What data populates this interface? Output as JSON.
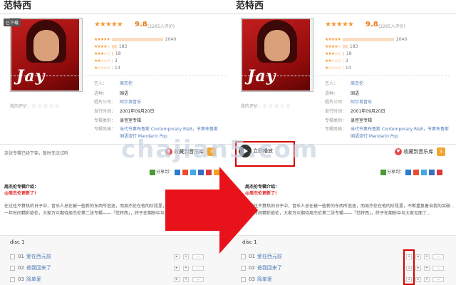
{
  "album": {
    "title": "范特西",
    "download_tag": "已下载",
    "score": "9.8",
    "rating_count": "(2265人评价)",
    "rating_rows": [
      {
        "stars": "★★★★★",
        "count": "2040",
        "fill": 0.9
      },
      {
        "stars": "★★★★☆",
        "count": "183",
        "fill": 0.08
      },
      {
        "stars": "★★★☆☆",
        "count": "18",
        "fill": 0.02
      },
      {
        "stars": "★★☆☆☆",
        "count": "3",
        "fill": 0.01
      },
      {
        "stars": "★☆☆☆☆",
        "count": "14",
        "fill": 0.01
      }
    ],
    "cover_text": "Jay",
    "info": {
      "artist_label": "艺人：",
      "artist_value": "周杰伦",
      "lang_label": "语种：",
      "lang_value": "国语",
      "company_label": "唱片公司：",
      "company_value": "阿尔发音乐",
      "date_label": "发行时间：",
      "date_value": "2001年09月20日",
      "type_label": "专辑类别：",
      "type_value": "录音室专辑",
      "genre_label": "专辑风格：",
      "genre_value_1": "当代节奏布鲁斯 Contemporary R&B，节奏布鲁斯",
      "genre_value_2": "国语流行 Mandarin Pop"
    },
    "my_rating_label": "我的评价：",
    "my_rating_stars": "☆☆☆☆☆"
  },
  "actions": {
    "unavailable": "这张专辑已经下架，暂时无法试听",
    "play_label": "立即播放",
    "fav_label": "收藏到音乐库",
    "share_label": "分享到：",
    "share_colors": [
      "#4c9a3a",
      "#2b7bd3",
      "#e84e2f",
      "#42a9e5",
      "#3a6fc1",
      "#d93b3b",
      "#f4a124"
    ]
  },
  "intro": {
    "title": "周杰伦专辑介绍：",
    "subtitle": "@周杰伦更新了!",
    "body_1": "在过往不算热的日子中，音乐人总在被一些新的东西所追逐，而周杰伦在他的阶段里，不断重复着自我的突破...",
    "body_2": "一年时间精彩绝伦，大家万众期待周杰伦第二张专辑——「范特西」，终于在期盼中与大家见面了..."
  },
  "disc": {
    "label": "disc 1",
    "tracks": [
      {
        "no": "01",
        "title": "爱在西元前"
      },
      {
        "no": "02",
        "title": "爸我回来了"
      },
      {
        "no": "03",
        "title": "简单爱"
      }
    ]
  },
  "watermark": "chajian5.com"
}
